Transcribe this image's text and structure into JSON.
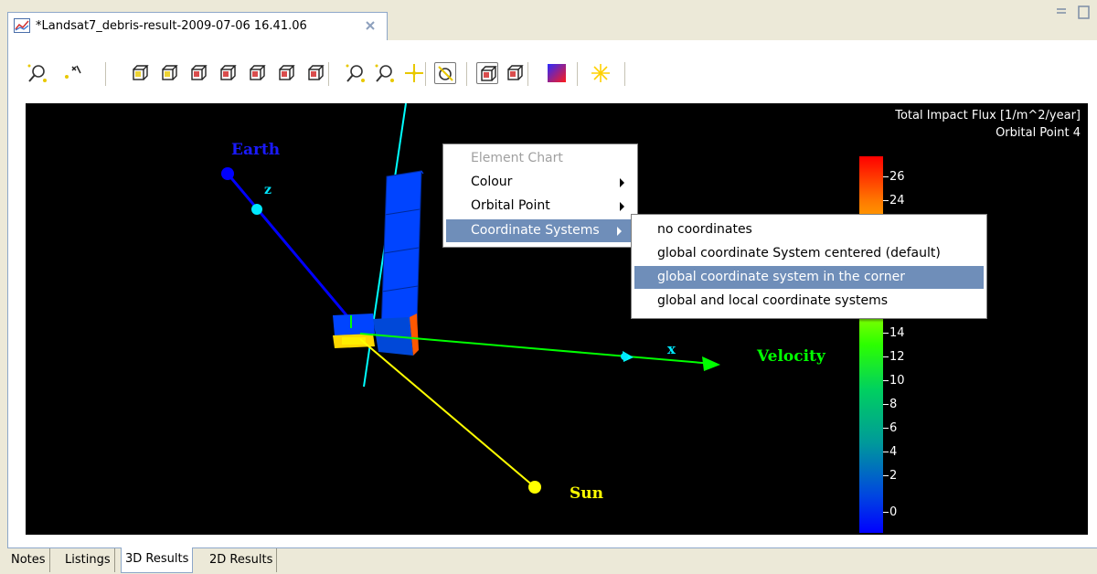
{
  "editor_tab": {
    "title": "*Landsat7_debris-result-2009-07-06 16.41.06",
    "icon": "chart-icon",
    "close_icon": "close-icon"
  },
  "toolbar": {
    "buttons": [
      "zoom-icon",
      "rotate-icon",
      "view-front-icon",
      "view-back-icon",
      "view-left-icon",
      "view-right-icon",
      "view-top-icon",
      "view-bottom-icon",
      "view-iso-icon",
      "zoom-box-icon",
      "zoom-out-icon",
      "pan-icon",
      "select-rotate-icon",
      "perspective-icon",
      "parallel-icon",
      "colour-gradient-icon",
      "light-icon"
    ]
  },
  "scene": {
    "labels": {
      "earth": "Earth",
      "z": "z",
      "x": "x",
      "velocity": "Velocity",
      "sun": "Sun"
    },
    "colors": {
      "earth": "#0000ff",
      "z_axis": "#00ffff",
      "velocity": "#00ff00",
      "sun": "#ffff00"
    }
  },
  "legend": {
    "title_line1": "Total Impact Flux [1/m^2/year]",
    "title_line2": "Orbital Point 4",
    "ticks": [
      "26",
      "24",
      "14",
      "12",
      "10",
      "8",
      "6",
      "4",
      "2",
      "0"
    ]
  },
  "context_menu": {
    "items": [
      {
        "label": "Element Chart",
        "disabled": true
      },
      {
        "label": "Colour",
        "submenu": true
      },
      {
        "label": "Orbital Point",
        "submenu": true
      },
      {
        "label": "Coordinate Systems",
        "submenu": true,
        "highlighted": true
      }
    ]
  },
  "submenu": {
    "items": [
      {
        "label": "no coordinates"
      },
      {
        "label": "global coordinate System centered (default)"
      },
      {
        "label": "global coordinate system in the corner",
        "highlighted": true
      },
      {
        "label": "global and local coordinate systems"
      }
    ]
  },
  "bottom_tabs": [
    "Notes",
    "Listings",
    "3D Results",
    "2D Results"
  ],
  "active_bottom_tab": "3D Results"
}
